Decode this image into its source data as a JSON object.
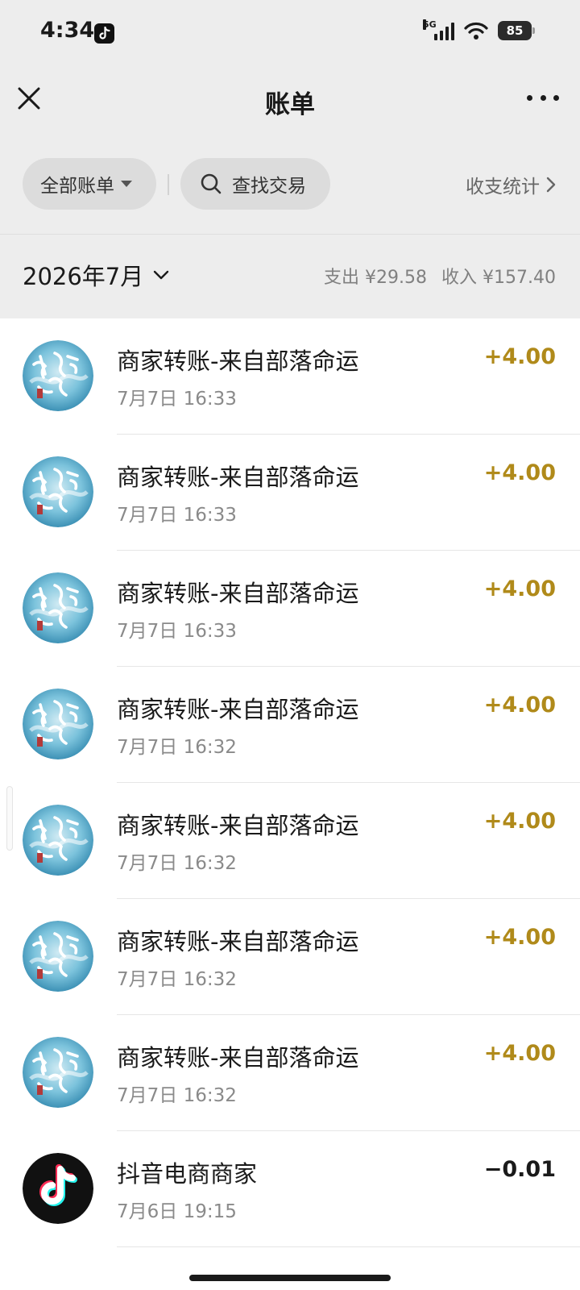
{
  "status": {
    "time": "4:34",
    "network": "5G",
    "battery": "85"
  },
  "nav": {
    "title": "账单"
  },
  "filters": {
    "all_label": "全部账单",
    "search_label": "查找交易",
    "stats_label": "收支统计"
  },
  "month": {
    "label": "2026年7月",
    "expense": "支出 ¥29.58",
    "income": "收入 ¥157.40"
  },
  "colors": {
    "income_amount": "#b08a1a",
    "top_bg": "#ededed",
    "avatar_teal": "#4aa7c8"
  },
  "transactions": [
    {
      "title": "商家转账-来自部落命运",
      "time": "7月7日 16:33",
      "amount": "+4.00",
      "icon": "buluo-mingyun-logo"
    },
    {
      "title": "商家转账-来自部落命运",
      "time": "7月7日 16:33",
      "amount": "+4.00",
      "icon": "buluo-mingyun-logo"
    },
    {
      "title": "商家转账-来自部落命运",
      "time": "7月7日 16:33",
      "amount": "+4.00",
      "icon": "buluo-mingyun-logo"
    },
    {
      "title": "商家转账-来自部落命运",
      "time": "7月7日 16:32",
      "amount": "+4.00",
      "icon": "buluo-mingyun-logo"
    },
    {
      "title": "商家转账-来自部落命运",
      "time": "7月7日 16:32",
      "amount": "+4.00",
      "icon": "buluo-mingyun-logo"
    },
    {
      "title": "商家转账-来自部落命运",
      "time": "7月7日 16:32",
      "amount": "+4.00",
      "icon": "buluo-mingyun-logo"
    },
    {
      "title": "商家转账-来自部落命运",
      "time": "7月7日 16:32",
      "amount": "+4.00",
      "icon": "buluo-mingyun-logo"
    },
    {
      "title": "抖音电商商家",
      "time": "7月6日 19:15",
      "amount": "−0.01",
      "icon": "douyin-logo"
    }
  ]
}
